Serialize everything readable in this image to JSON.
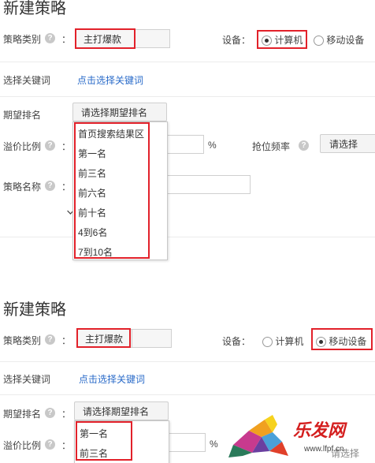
{
  "section1": {
    "title": "新建策略",
    "strategy_type_label": "策略类别",
    "strategy_type_value": "主打爆款",
    "device_label": "设备：",
    "device_options": [
      "计算机",
      "移动设备"
    ],
    "keyword_label": "选择关键词",
    "keyword_link": "点击选择关键词",
    "rank_label": "期望排名",
    "rank_button": "请选择期望排名",
    "rank_options": [
      "首页搜索结果区",
      "第一名",
      "前三名",
      "前六名",
      "前十名",
      "4到6名",
      "7到10名"
    ],
    "premium_label": "溢价比例",
    "percent": "%",
    "freq_label": "抢位频率",
    "freq_value": "请选择",
    "name_label": "策略名称",
    "colon": "："
  },
  "section2": {
    "title": "新建策略",
    "strategy_type_label": "策略类别",
    "strategy_type_value": "主打爆款",
    "device_label": "设备：",
    "device_options": [
      "计算机",
      "移动设备"
    ],
    "keyword_label": "选择关键词",
    "keyword_link": "点击选择关键词",
    "rank_label": "期望排名",
    "rank_button": "请选择期望排名",
    "rank_options": [
      "第一名",
      "前三名"
    ],
    "premium_label": "溢价比例",
    "percent": "%",
    "freq_value": "请选择",
    "colon": "："
  },
  "watermark": {
    "text": "乐发网",
    "url": "www.lfpf.cn"
  },
  "colors": {
    "highlight": "#e2212a",
    "link": "#2a6bc9",
    "watermark": "#d41e1e"
  }
}
